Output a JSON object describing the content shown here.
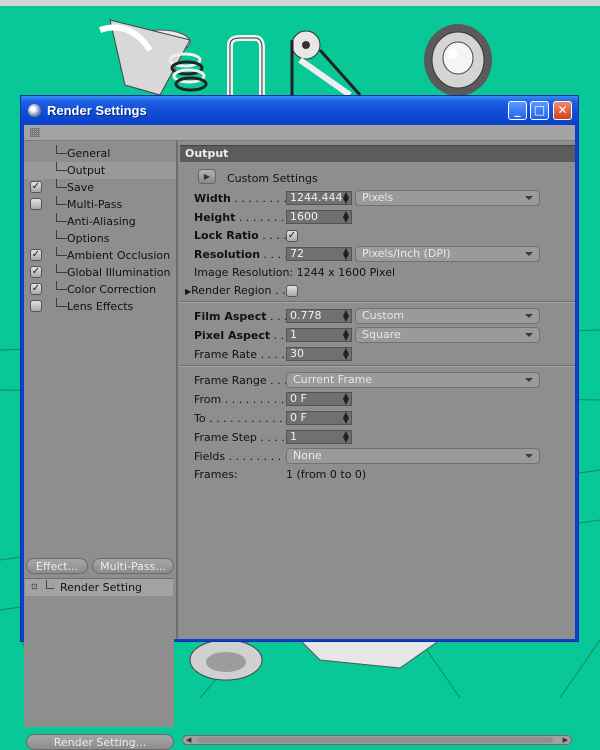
{
  "window": {
    "title": "Render Settings",
    "controls": {
      "minimize": "_",
      "maximize": "□",
      "close": "✕"
    }
  },
  "sidebar": {
    "items": [
      {
        "label": "General",
        "checkbox": false,
        "checked": false
      },
      {
        "label": "Output",
        "checkbox": false,
        "checked": false,
        "selected": true
      },
      {
        "label": "Save",
        "checkbox": true,
        "checked": true
      },
      {
        "label": "Multi-Pass",
        "checkbox": true,
        "checked": false
      },
      {
        "label": "Anti-Aliasing",
        "checkbox": false,
        "checked": false
      },
      {
        "label": "Options",
        "checkbox": false,
        "checked": false
      },
      {
        "label": "Ambient Occlusion",
        "checkbox": true,
        "checked": true
      },
      {
        "label": "Global Illumination",
        "checkbox": true,
        "checked": true
      },
      {
        "label": "Color Correction",
        "checkbox": true,
        "checked": true
      },
      {
        "label": "Lens Effects",
        "checkbox": true,
        "checked": false
      }
    ],
    "effect_button": "Effect...",
    "multipass_button": "Multi-Pass...",
    "render_setting_item": "Render Setting",
    "render_setting_button": "Render Setting..."
  },
  "output": {
    "section_title": "Output",
    "preset": "Custom Settings",
    "width_label": "Width",
    "width_value": "1244.444",
    "width_unit": "Pixels",
    "height_label": "Height",
    "height_value": "1600",
    "lock_ratio_label": "Lock Ratio",
    "lock_ratio_checked": true,
    "resolution_label": "Resolution",
    "resolution_value": "72",
    "resolution_unit": "Pixels/Inch (DPI)",
    "image_resolution_text": "Image Resolution: 1244 x 1600 Pixel",
    "render_region_label": "Render Region",
    "film_aspect_label": "Film Aspect",
    "film_aspect_value": "0.778",
    "film_aspect_preset": "Custom",
    "pixel_aspect_label": "Pixel Aspect",
    "pixel_aspect_value": "1",
    "pixel_aspect_preset": "Square",
    "frame_rate_label": "Frame Rate",
    "frame_rate_value": "30",
    "frame_range_label": "Frame Range",
    "frame_range_value": "Current Frame",
    "from_label": "From",
    "from_value": "0 F",
    "to_label": "To",
    "to_value": "0 F",
    "frame_step_label": "Frame Step",
    "frame_step_value": "1",
    "fields_label": "Fields",
    "fields_value": "None",
    "frames_label": "Frames:",
    "frames_value": "1 (from 0 to 0)"
  },
  "colors": {
    "viewport_bg": "#07c896",
    "titlebar": "#0f4cd8",
    "panel": "#8e8e8e",
    "field": "#707070"
  }
}
